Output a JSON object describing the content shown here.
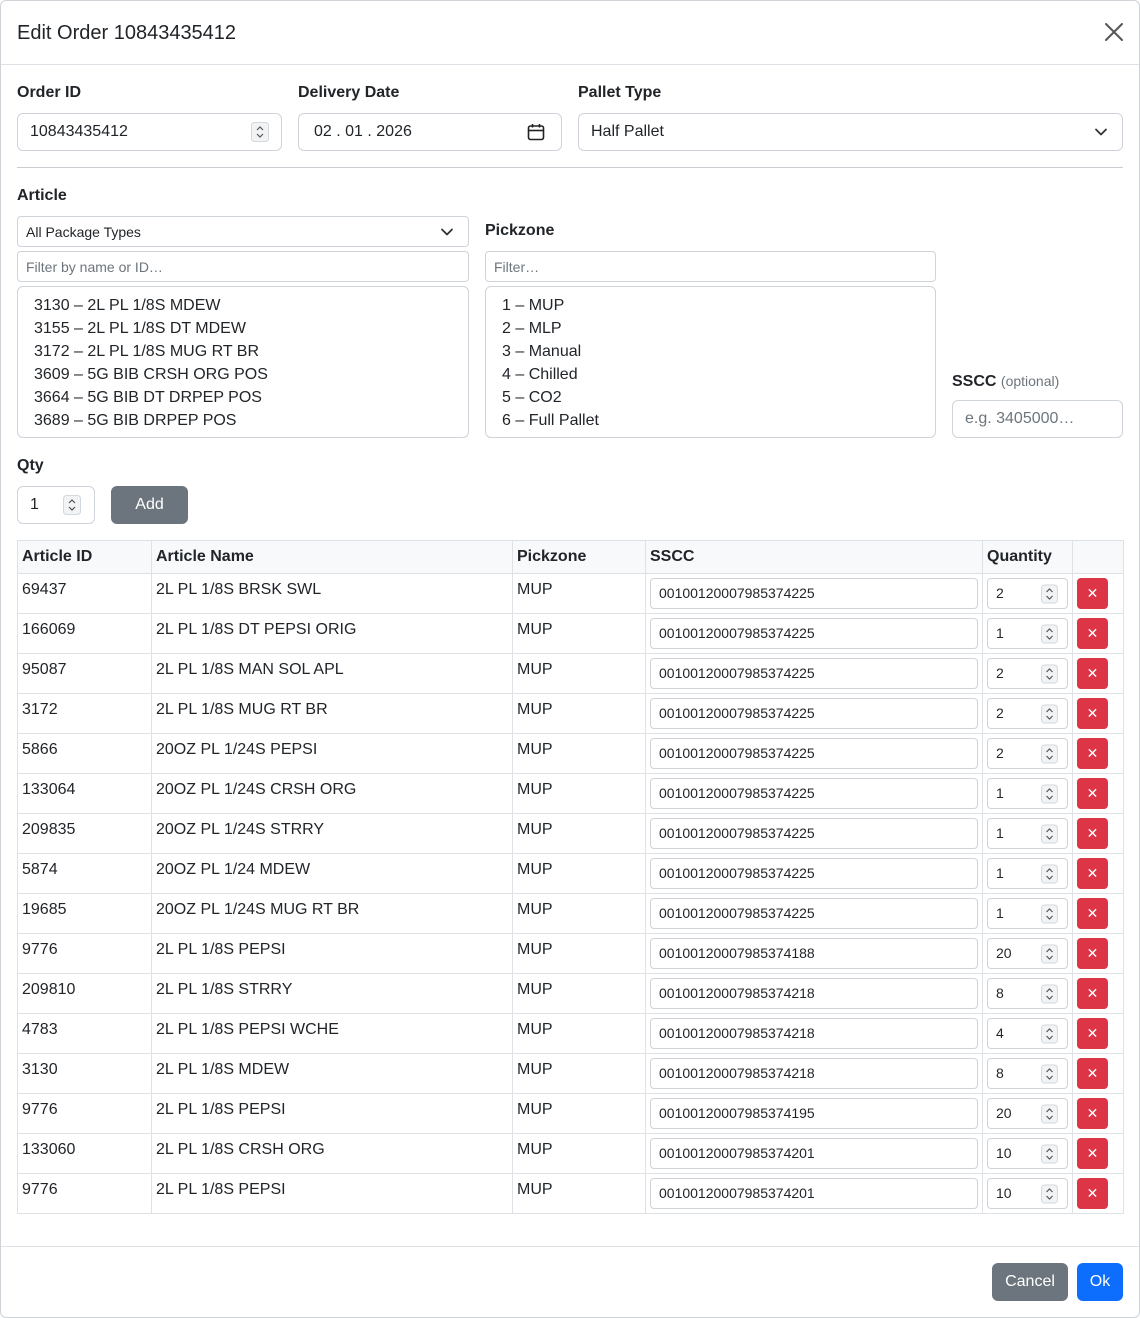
{
  "header": {
    "title": "Edit Order 10843435412"
  },
  "order_id": {
    "label": "Order ID",
    "value": "10843435412"
  },
  "delivery_date": {
    "label": "Delivery Date",
    "value": "02 . 01 . 2026"
  },
  "pallet_type": {
    "label": "Pallet Type",
    "value": "Half Pallet"
  },
  "article": {
    "label": "Article",
    "package_filter": "All Package Types",
    "filter_placeholder": "Filter by name or ID…",
    "options": [
      "3130 – 2L PL 1/8S MDEW",
      "3155 – 2L PL 1/8S DT MDEW",
      "3172 – 2L PL 1/8S MUG RT BR",
      "3609 – 5G BIB CRSH ORG POS",
      "3664 – 5G BIB DT DRPEP POS",
      "3689 – 5G BIB DRPEP POS"
    ]
  },
  "pickzone": {
    "label": "Pickzone",
    "filter_placeholder": "Filter…",
    "options": [
      "1 – MUP",
      "2 – MLP",
      "3 – Manual",
      "4 – Chilled",
      "5 – CO2",
      "6 – Full Pallet"
    ]
  },
  "sscc": {
    "label": "SSCC",
    "optional": "(optional)",
    "placeholder": "e.g. 3405000…"
  },
  "qty": {
    "label": "Qty",
    "value": "1"
  },
  "add_button": "Add",
  "table": {
    "headers": [
      "Article ID",
      "Article Name",
      "Pickzone",
      "SSCC",
      "Quantity",
      ""
    ],
    "delete_glyph": "✕",
    "rows": [
      {
        "id": "69437",
        "name": "2L PL 1/8S BRSK SWL",
        "zone": "MUP",
        "sscc": "00100120007985374225",
        "qty": "2"
      },
      {
        "id": "166069",
        "name": "2L PL 1/8S DT PEPSI ORIG",
        "zone": "MUP",
        "sscc": "00100120007985374225",
        "qty": "1"
      },
      {
        "id": "95087",
        "name": "2L PL 1/8S MAN SOL APL",
        "zone": "MUP",
        "sscc": "00100120007985374225",
        "qty": "2"
      },
      {
        "id": "3172",
        "name": "2L PL 1/8S MUG RT BR",
        "zone": "MUP",
        "sscc": "00100120007985374225",
        "qty": "2"
      },
      {
        "id": "5866",
        "name": "20OZ PL 1/24S PEPSI",
        "zone": "MUP",
        "sscc": "00100120007985374225",
        "qty": "2"
      },
      {
        "id": "133064",
        "name": "20OZ PL 1/24S CRSH ORG",
        "zone": "MUP",
        "sscc": "00100120007985374225",
        "qty": "1"
      },
      {
        "id": "209835",
        "name": "20OZ PL 1/24S STRRY",
        "zone": "MUP",
        "sscc": "00100120007985374225",
        "qty": "1"
      },
      {
        "id": "5874",
        "name": "20OZ PL 1/24 MDEW",
        "zone": "MUP",
        "sscc": "00100120007985374225",
        "qty": "1"
      },
      {
        "id": "19685",
        "name": "20OZ PL 1/24S MUG RT BR",
        "zone": "MUP",
        "sscc": "00100120007985374225",
        "qty": "1"
      },
      {
        "id": "9776",
        "name": "2L PL 1/8S PEPSI",
        "zone": "MUP",
        "sscc": "00100120007985374188",
        "qty": "20"
      },
      {
        "id": "209810",
        "name": "2L PL 1/8S STRRY",
        "zone": "MUP",
        "sscc": "00100120007985374218",
        "qty": "8"
      },
      {
        "id": "4783",
        "name": "2L PL 1/8S PEPSI WCHE",
        "zone": "MUP",
        "sscc": "00100120007985374218",
        "qty": "4"
      },
      {
        "id": "3130",
        "name": "2L PL 1/8S MDEW",
        "zone": "MUP",
        "sscc": "00100120007985374218",
        "qty": "8"
      },
      {
        "id": "9776",
        "name": "2L PL 1/8S PEPSI",
        "zone": "MUP",
        "sscc": "00100120007985374195",
        "qty": "20"
      },
      {
        "id": "133060",
        "name": "2L PL 1/8S CRSH ORG",
        "zone": "MUP",
        "sscc": "00100120007985374201",
        "qty": "10"
      },
      {
        "id": "9776",
        "name": "2L PL 1/8S PEPSI",
        "zone": "MUP",
        "sscc": "00100120007985374201",
        "qty": "10"
      }
    ]
  },
  "footer": {
    "cancel": "Cancel",
    "ok": "Ok"
  },
  "icons": {
    "close": "close-icon",
    "calendar": "calendar-icon",
    "chevron": "chevron-down-icon",
    "spinner": "spinner-icon",
    "delete": "x-icon"
  },
  "colors": {
    "primary": "#0d6efd",
    "secondary": "#6c757d",
    "danger": "#dc3545",
    "border": "#ced4da"
  }
}
